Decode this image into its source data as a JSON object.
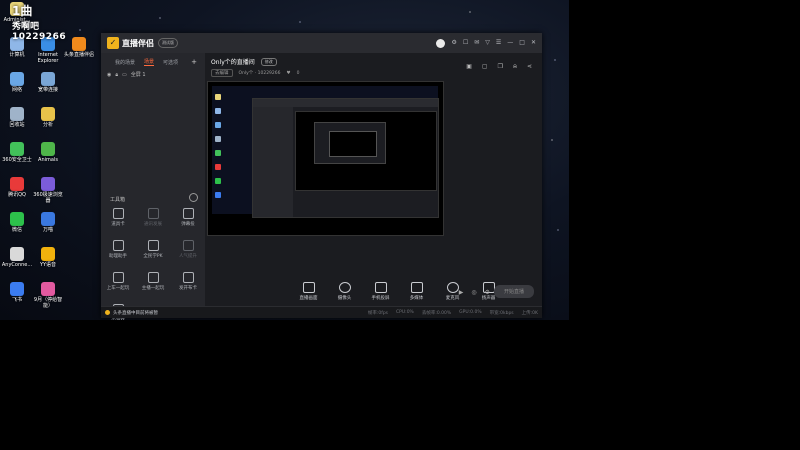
{
  "overlay": {
    "line1": "1曲",
    "line2": "秀啊吧",
    "line3": "10229266"
  },
  "desktop": {
    "icons": [
      {
        "label": "Administ...",
        "color": "#e9d57a",
        "col": 0,
        "row": 0
      },
      {
        "label": "计算机",
        "color": "#8fb7e8",
        "col": 0,
        "row": 1
      },
      {
        "label": "网络",
        "color": "#6aa7e5",
        "col": 0,
        "row": 2
      },
      {
        "label": "回收站",
        "color": "#9fb3c9",
        "col": 0,
        "row": 3
      },
      {
        "label": "360安全卫士",
        "color": "#42c15a",
        "col": 0,
        "row": 4
      },
      {
        "label": "腾讯QQ",
        "color": "#e83a3a",
        "col": 0,
        "row": 5
      },
      {
        "label": "微信",
        "color": "#2dc14b",
        "col": 0,
        "row": 6
      },
      {
        "label": "AnyConne...",
        "color": "#d9d9d9",
        "col": 0,
        "row": 7
      },
      {
        "label": "飞书",
        "color": "#3b7cf0",
        "col": 0,
        "row": 8
      },
      {
        "label": "Internet Explorer",
        "color": "#3a8ee6",
        "col": 1,
        "row": 1
      },
      {
        "label": "宽带连接",
        "color": "#7aa6d6",
        "col": 1,
        "row": 2
      },
      {
        "label": "分析",
        "color": "#e8c24a",
        "col": 1,
        "row": 3
      },
      {
        "label": "Animals",
        "color": "#4fb64a",
        "col": 1,
        "row": 4
      },
      {
        "label": "360极速浏览器",
        "color": "#7b5cd9",
        "col": 1,
        "row": 5
      },
      {
        "label": "万喵",
        "color": "#3a78e0",
        "col": 1,
        "row": 6
      },
      {
        "label": "YY语音",
        "color": "#f2b20d",
        "col": 1,
        "row": 7
      },
      {
        "label": "9月（停给智能）",
        "color": "#e25aa0",
        "col": 1,
        "row": 8
      },
      {
        "label": "头条直播伴侣",
        "color": "#f08a1c",
        "col": 2,
        "row": 1
      }
    ]
  },
  "app": {
    "logo_text": "直播伴侣",
    "version": "测试版",
    "window_controls": [
      "⚙",
      "☐",
      "✉",
      "▽",
      "☰",
      "—",
      "□",
      "✕"
    ],
    "tabs": [
      {
        "label": "我的场景",
        "active": false
      },
      {
        "label": "场景",
        "active": true
      },
      {
        "label": "可选项",
        "active": false
      }
    ],
    "scene_item": "全屏 1",
    "tools_title": "工具箱",
    "tools": [
      {
        "label": "道具卡",
        "dim": false
      },
      {
        "label": "通讯发展",
        "dim": true
      },
      {
        "label": "弹幕投",
        "dim": false
      },
      {
        "label": "助理助手",
        "dim": false
      },
      {
        "label": "全民学PK",
        "dim": false
      },
      {
        "label": "人气提升",
        "dim": true
      },
      {
        "label": "上车一起玩",
        "dim": false
      },
      {
        "label": "主播一起玩",
        "dim": false
      },
      {
        "label": "发开布卡",
        "dim": false
      },
      {
        "label": "小游戏",
        "dim": false
      }
    ],
    "room": {
      "title": "Only个的直播间",
      "badge": "修改",
      "chip": "去编辑",
      "id_label": "Only个 · 10229266",
      "likes": "0"
    },
    "bottom_items": [
      {
        "label": "直播画面",
        "shape": "square"
      },
      {
        "label": "摄像头",
        "shape": "round"
      },
      {
        "label": "手机投屏",
        "shape": "square"
      },
      {
        "label": "多媒体",
        "shape": "square"
      },
      {
        "label": "麦克风",
        "shape": "round"
      },
      {
        "label": "扬声器",
        "shape": "square"
      }
    ],
    "start_label": "开始直播",
    "status_msg": "头条直播中目前将被暂",
    "stats": [
      "帧率:0fps",
      "CPU:0%",
      "丢帧率:0.00%",
      "GPU:0.0%",
      "带宽:0kbps",
      "上传:0K"
    ]
  }
}
